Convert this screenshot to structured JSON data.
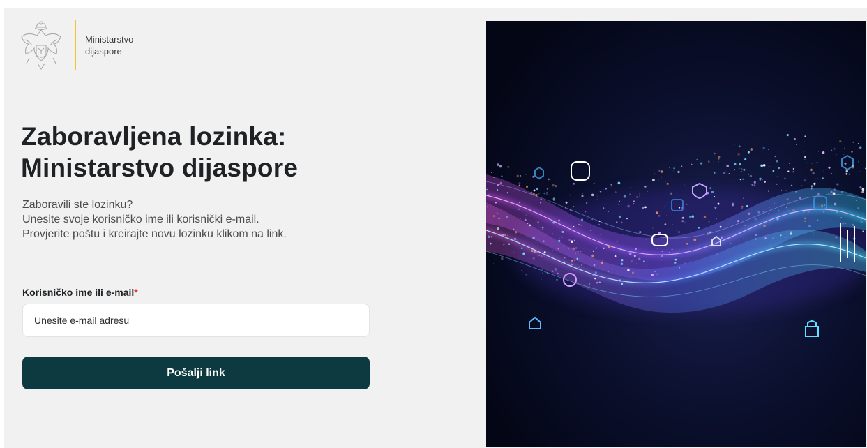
{
  "header": {
    "ministry_line1": "Ministarstvo",
    "ministry_line2": "dijaspore",
    "divider_color": "#f2c230"
  },
  "page": {
    "title_line1": "Zaboravljena lozinka:",
    "title_line2": "Ministarstvo dijaspore",
    "desc_line1": "Zaboravili ste lozinku?",
    "desc_line2": "Unesite svoje korisničko ime ili korisnički e-mail.",
    "desc_line3": "Provjerite poštu i kreirajte novu lozinku klikom na link."
  },
  "form": {
    "field_label": "Korisničko ime ili e-mail",
    "required_mark": "*",
    "input_placeholder": "Unesite e-mail adresu",
    "input_value": "",
    "submit_label": "Pošalji link",
    "button_color": "#0c3a40"
  },
  "hero": {
    "icons": [
      "robot-icon",
      "lock-icon",
      "shield-icon",
      "home-icon",
      "chat-icon",
      "gear-icon",
      "equalizer-icon"
    ]
  }
}
